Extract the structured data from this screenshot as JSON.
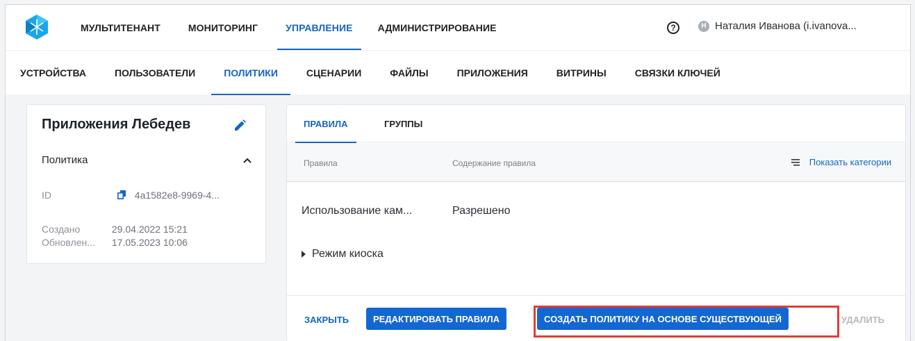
{
  "top_nav": {
    "items": [
      "МУЛЬТИТЕНАНТ",
      "МОНИТОРИНГ",
      "УПРАВЛЕНИЕ",
      "АДМИНИСТРИРОВАНИЕ"
    ],
    "active": "УПРАВЛЕНИЕ"
  },
  "user": {
    "initial": "Н",
    "name": "Наталия Иванова (i.ivanova..."
  },
  "help_glyph": "?",
  "sub_nav": {
    "items": [
      "УСТРОЙСТВА",
      "ПОЛЬЗОВАТЕЛИ",
      "ПОЛИТИКИ",
      "СЦЕНАРИИ",
      "ФАЙЛЫ",
      "ПРИЛОЖЕНИЯ",
      "ВИТРИНЫ",
      "СВЯЗКИ КЛЮЧЕЙ"
    ],
    "active": "ПОЛИТИКИ"
  },
  "policy_card": {
    "title": "Приложения Лебедев",
    "section": "Политика",
    "id_label": "ID",
    "id_value": "4a1582e8-9969-4...",
    "created_label": "Создано",
    "created_value": "29.04.2022 15:21",
    "updated_label": "Обновлен...",
    "updated_value": "17.05.2023 10:06"
  },
  "panel": {
    "tabs": [
      "ПРАВИЛА",
      "ГРУППЫ"
    ],
    "active_tab": "ПРАВИЛА",
    "col_rules": "Правила",
    "col_content": "Содержание правила",
    "show_categories": "Показать категории",
    "rows": [
      {
        "rule": "Использование кам...",
        "content": "Разрешено"
      }
    ],
    "group": "Режим киоска",
    "actions": {
      "close": "ЗАКРЫТЬ",
      "edit": "РЕДАКТИРОВАТЬ ПРАВИЛА",
      "create": "СОЗДАТЬ ПОЛИТИКУ НА ОСНОВЕ СУЩЕСТВУЮЩЕЙ",
      "delete": "УДАЛИТЬ"
    }
  },
  "colors": {
    "accent": "#1565c0",
    "button": "#1367d2",
    "highlight": "#e23b3b"
  },
  "icons": [
    "app-logo-icon",
    "help-icon",
    "pencil-icon",
    "chevron-up-icon",
    "copy-icon",
    "list-icon",
    "triangle-right-icon"
  ]
}
